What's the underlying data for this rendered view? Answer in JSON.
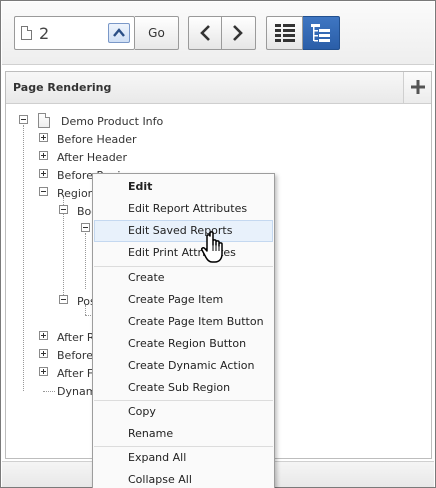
{
  "toolbar": {
    "page_value": "2",
    "go_label": "Go",
    "up_icon": "chevron-up-icon",
    "prev_icon": "chevron-left-icon",
    "next_icon": "chevron-right-icon",
    "grid_view_icon": "grid-view-icon",
    "tree_view_icon": "tree-view-icon",
    "active_view": "tree",
    "accent_color": "#2f65b0"
  },
  "panel": {
    "title": "Page Rendering",
    "add_icon": "plus-icon"
  },
  "tree": {
    "root_label": "Demo Product Info",
    "items": [
      {
        "label": "Before Header"
      },
      {
        "label": "After Header"
      },
      {
        "label": "Before Regions"
      },
      {
        "label": "Regions"
      },
      {
        "label": "Body"
      },
      {
        "label": "Position 01"
      },
      {
        "label": "After Regions"
      },
      {
        "label": "Before Footer"
      },
      {
        "label": "After Footer"
      },
      {
        "label": "Dynamic Actions"
      }
    ]
  },
  "context_menu": {
    "hovered_item": "Edit Saved Reports",
    "groups": [
      [
        {
          "label": "Edit",
          "bold": true
        },
        {
          "label": "Edit Report Attributes"
        },
        {
          "label": "Edit Saved Reports"
        },
        {
          "label": "Edit Print Attributes"
        }
      ],
      [
        {
          "label": "Create"
        },
        {
          "label": "Create Page Item"
        },
        {
          "label": "Create Page Item Button"
        },
        {
          "label": "Create Region Button"
        },
        {
          "label": "Create Dynamic Action"
        },
        {
          "label": "Create Sub Region"
        }
      ],
      [
        {
          "label": "Copy"
        },
        {
          "label": "Rename"
        }
      ],
      [
        {
          "label": "Expand All"
        },
        {
          "label": "Collapse All"
        }
      ]
    ]
  },
  "cursor_icon": "hand-pointer-icon"
}
